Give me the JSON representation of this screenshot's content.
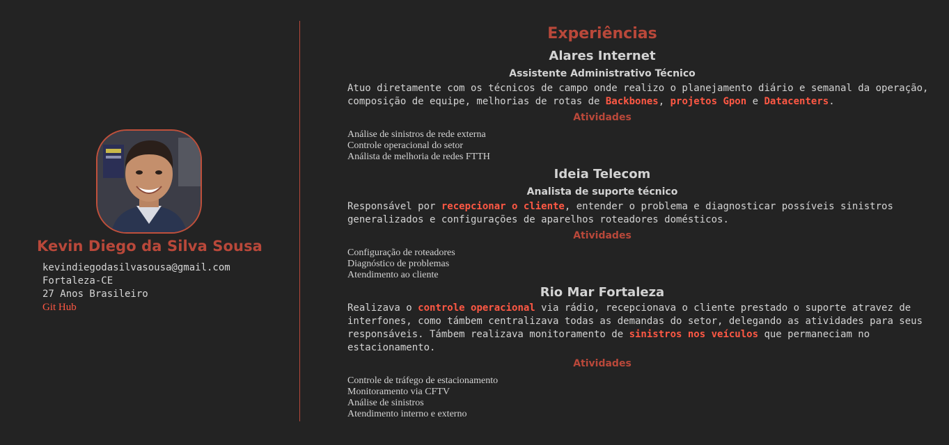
{
  "profile": {
    "name": "Kevin Diego da Silva Sousa",
    "email": "kevindiegodasilvasousa@gmail.com",
    "location": "Fortaleza-CE",
    "age_nationality": "27 Anos Brasileiro",
    "github_label": "Git Hub"
  },
  "colors": {
    "accent": "#b9483a",
    "highlight": "#ff5844",
    "background": "#232323"
  },
  "experience": {
    "title": "Experiências",
    "jobs": [
      {
        "company": "Alares Internet",
        "role": "Assistente Administrativo Técnico",
        "desc": {
          "t1": "Atuo diretamente com os técnicos de campo onde realizo o planejamento diário e semanal da operação, composição de equipe, melhorias de rotas de ",
          "h1": "Backbones",
          "t2": ", ",
          "h2": "projetos Gpon",
          "t3": " e ",
          "h3": "Datacenters",
          "t4": "."
        },
        "activities_title": "Atividades",
        "activities": [
          "Análise de sinistros de rede externa",
          "Controle operacional do setor",
          "Análista de melhoria de redes FTTH"
        ]
      },
      {
        "company": "Ideia Telecom",
        "role": "Analista de suporte técnico",
        "desc": {
          "t1": "Responsável por ",
          "h1": "recepcionar o cliente",
          "t2": ", entender o problema e diagnosticar possíveis sinistros generalizados e configurações de aparelhos roteadores domésticos."
        },
        "activities_title": "Atividades",
        "activities": [
          "Configuração de roteadores",
          "Diagnóstico de problemas",
          "Atendimento ao cliente"
        ]
      },
      {
        "company": "Rio Mar Fortaleza",
        "desc": {
          "t1": "Realizava o ",
          "h1": "controle operacional",
          "t2": " via rádio, recepcionava o cliente prestado o suporte atravez de interfones, como támbem centralizava todas as demandas do setor, delegando as atividades para seus responsáveis. Támbem realizava monitoramento de ",
          "h2": "sinistros nos veículos",
          "t3": " que permaneciam no estacionamento."
        },
        "activities_title": "Atividades",
        "activities": [
          "Controle de tráfego de estacionamento",
          "Monitoramento via CFTV",
          "Análise de sinistros",
          "Atendimento interno e externo"
        ]
      }
    ]
  }
}
